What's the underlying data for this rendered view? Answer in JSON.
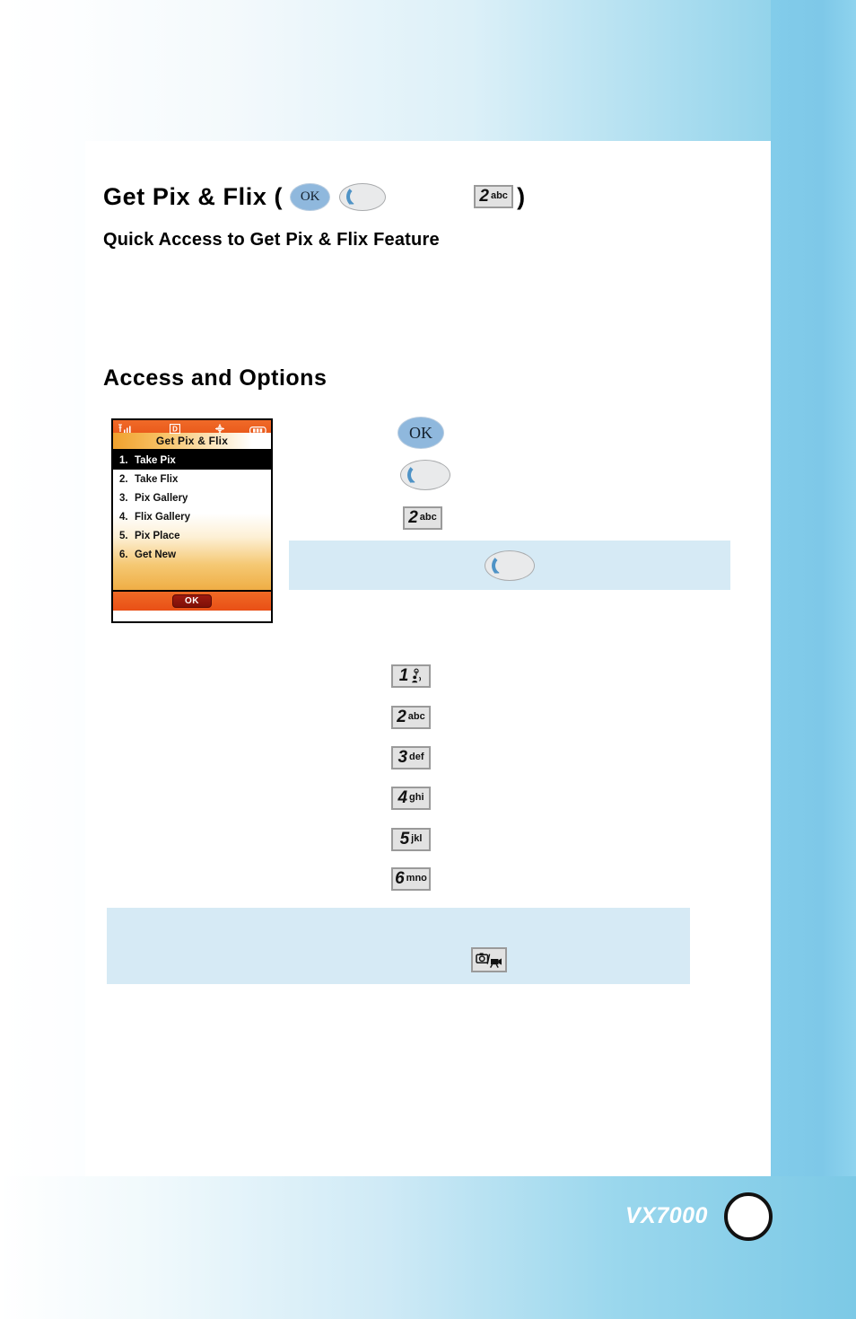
{
  "page": {
    "heading": "Get Pix & Flix (",
    "heading_close": ")",
    "subheading": "Quick Access to Get Pix & Flix Feature",
    "section_heading": "Access and Options"
  },
  "keys": {
    "ok_label": "OK",
    "side_key_name": "side-key",
    "two": {
      "digit": "2",
      "letters": "abc"
    },
    "one": {
      "digit": "1",
      "letters": ""
    },
    "three": {
      "digit": "3",
      "letters": "def"
    },
    "four": {
      "digit": "4",
      "letters": "ghi"
    },
    "five": {
      "digit": "5",
      "letters": "jkl"
    },
    "six": {
      "digit": "6",
      "letters": "mno"
    },
    "camera_key_name": "camera-camcorder-key"
  },
  "phone": {
    "status_bar": {
      "signal_icon": "signal-bars-icon",
      "digital_icon": "digital-mode-icon",
      "digital_label": "D",
      "location_icon": "location-crosshair-icon",
      "battery_icon": "battery-full-icon"
    },
    "title": "Get Pix & Flix",
    "menu": [
      {
        "index": "1.",
        "label": "Take Pix",
        "selected": true
      },
      {
        "index": "2.",
        "label": "Take Flix",
        "selected": false
      },
      {
        "index": "3.",
        "label": "Pix Gallery",
        "selected": false
      },
      {
        "index": "4.",
        "label": "Flix Gallery",
        "selected": false
      },
      {
        "index": "5.",
        "label": "Pix Place",
        "selected": false
      },
      {
        "index": "6.",
        "label": "Get New",
        "selected": false
      }
    ],
    "softkey": "OK"
  },
  "footer": {
    "model": "VX7000",
    "page_number": ""
  },
  "colors": {
    "accent_blue": "#7fcbe6",
    "note_box": "#d6eaf5",
    "status_orange": "#ea5b1c",
    "title_orange": "#f0a12e",
    "ok_key_blue": "#8fb8dd"
  }
}
